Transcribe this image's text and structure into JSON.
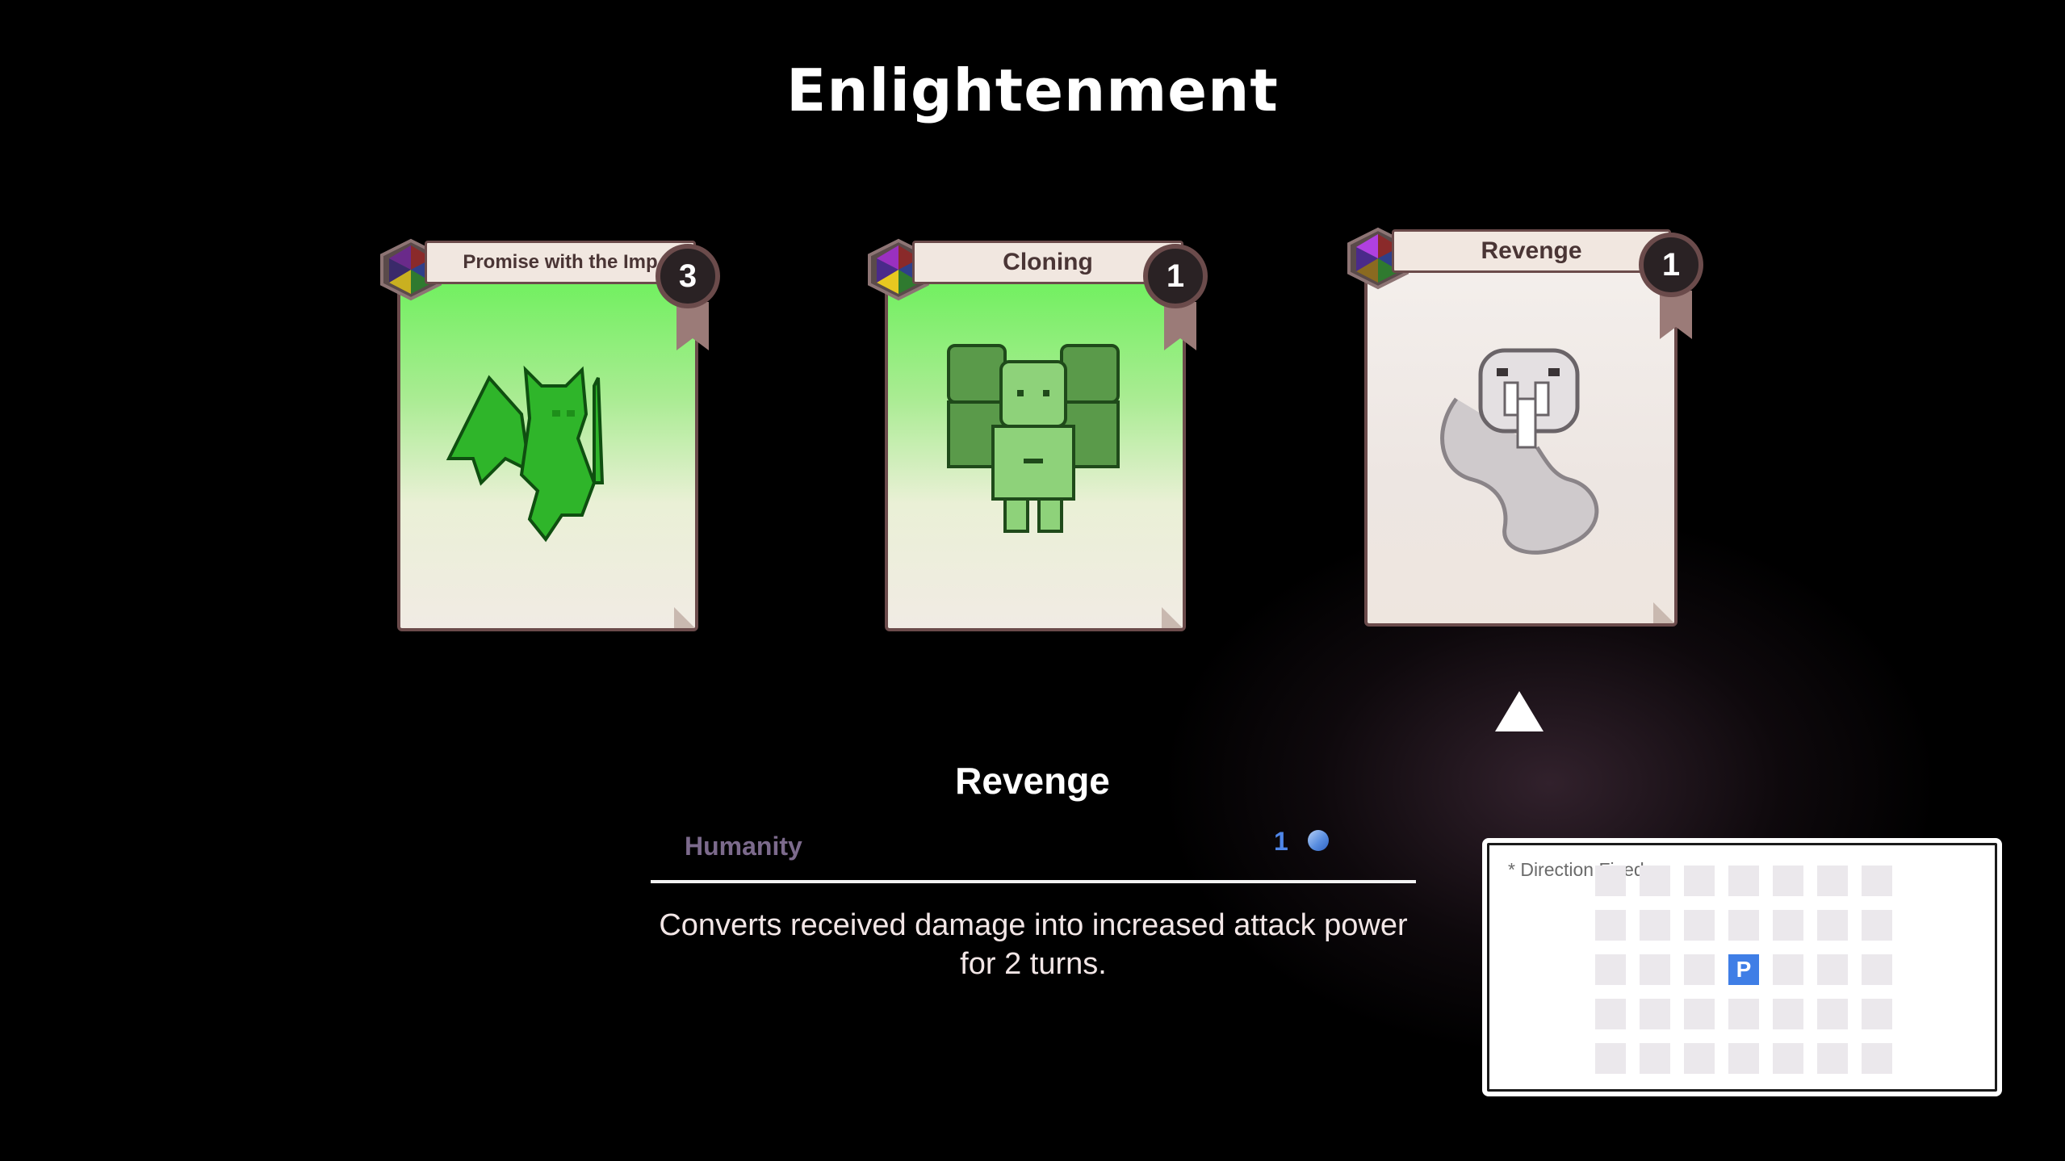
{
  "screen": {
    "title": "Enlightenment"
  },
  "cards": [
    {
      "name": "Promise with the Imp",
      "count": "3",
      "style": "green",
      "art_icon": "imp-icon"
    },
    {
      "name": "Cloning",
      "count": "1",
      "style": "green",
      "art_icon": "clones-icon"
    },
    {
      "name": "Revenge",
      "count": "1",
      "style": "white",
      "art_icon": "snake-icon"
    }
  ],
  "selected_index": 2,
  "detail": {
    "name": "Revenge",
    "type": "Humanity",
    "cost": "1",
    "cost_icon": "mana-orb-icon",
    "description": "Converts received damage into increased attack power for 2 turns."
  },
  "range": {
    "label": "* Direction Fixed",
    "player_marker": "P",
    "rows": 5,
    "cols": 7,
    "player_row": 2,
    "player_col": 3
  },
  "colors": {
    "player": "#3f7ee6",
    "cost": "#4f86e8",
    "type": "#7c6a8c"
  }
}
